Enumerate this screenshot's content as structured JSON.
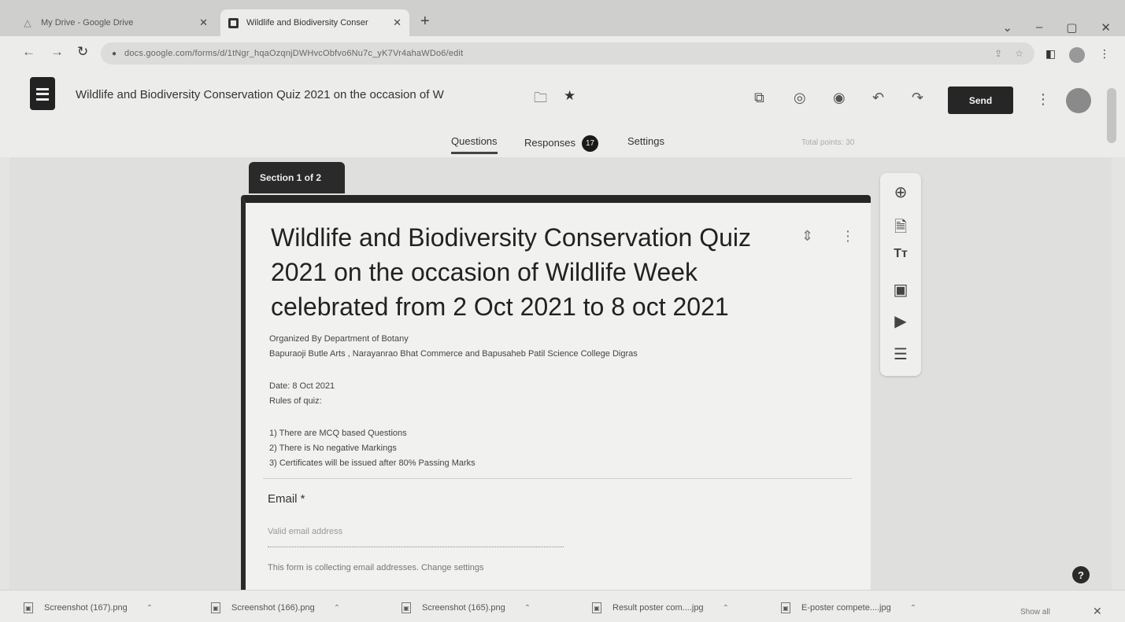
{
  "browser": {
    "tabs": [
      {
        "title": "My Drive - Google Drive",
        "active": false
      },
      {
        "title": "Wildlife and Biodiversity Conser",
        "active": true
      }
    ],
    "url": "docs.google.com/forms/d/1tNgr_hqaOzqnjDWHvcObfvo6Nu7c_yK7Vr4ahaWDo6/edit"
  },
  "forms": {
    "doc_title": "Wildlife and Biodiversity Conservation Quiz 2021 on the occasion of W",
    "send_label": "Send",
    "tabs": {
      "questions": "Questions",
      "responses": "Responses",
      "responses_count": "17",
      "settings": "Settings"
    },
    "total_points": "Total points: 30"
  },
  "section": {
    "label": "Section 1 of 2",
    "title": "Wildlife and Biodiversity Conservation Quiz 2021 on the occasion of Wildlife Week celebrated from 2 Oct 2021 to 8 oct 2021",
    "desc_line1": "Organized By Department of Botany",
    "desc_line2": "Bapuraoji Butle Arts , Narayanrao Bhat Commerce and Bapusaheb Patil Science College Digras",
    "date": "Date: 8 Oct 2021",
    "rules_heading": "Rules of quiz:",
    "rule1": "1) There are MCQ based Questions",
    "rule2": "2) There is No negative Markings",
    "rule3": "3) Certificates will be issued after 80% Passing Marks"
  },
  "question": {
    "label": "Email *",
    "placeholder": "Valid email address",
    "note": "This form is collecting email addresses.  Change settings"
  },
  "downloads": [
    {
      "name": "Screenshot (167).png"
    },
    {
      "name": "Screenshot (166).png"
    },
    {
      "name": "Screenshot (165).png"
    },
    {
      "name": "Result poster com....jpg"
    },
    {
      "name": "E-poster compete....jpg"
    }
  ],
  "show_all": "Show all"
}
